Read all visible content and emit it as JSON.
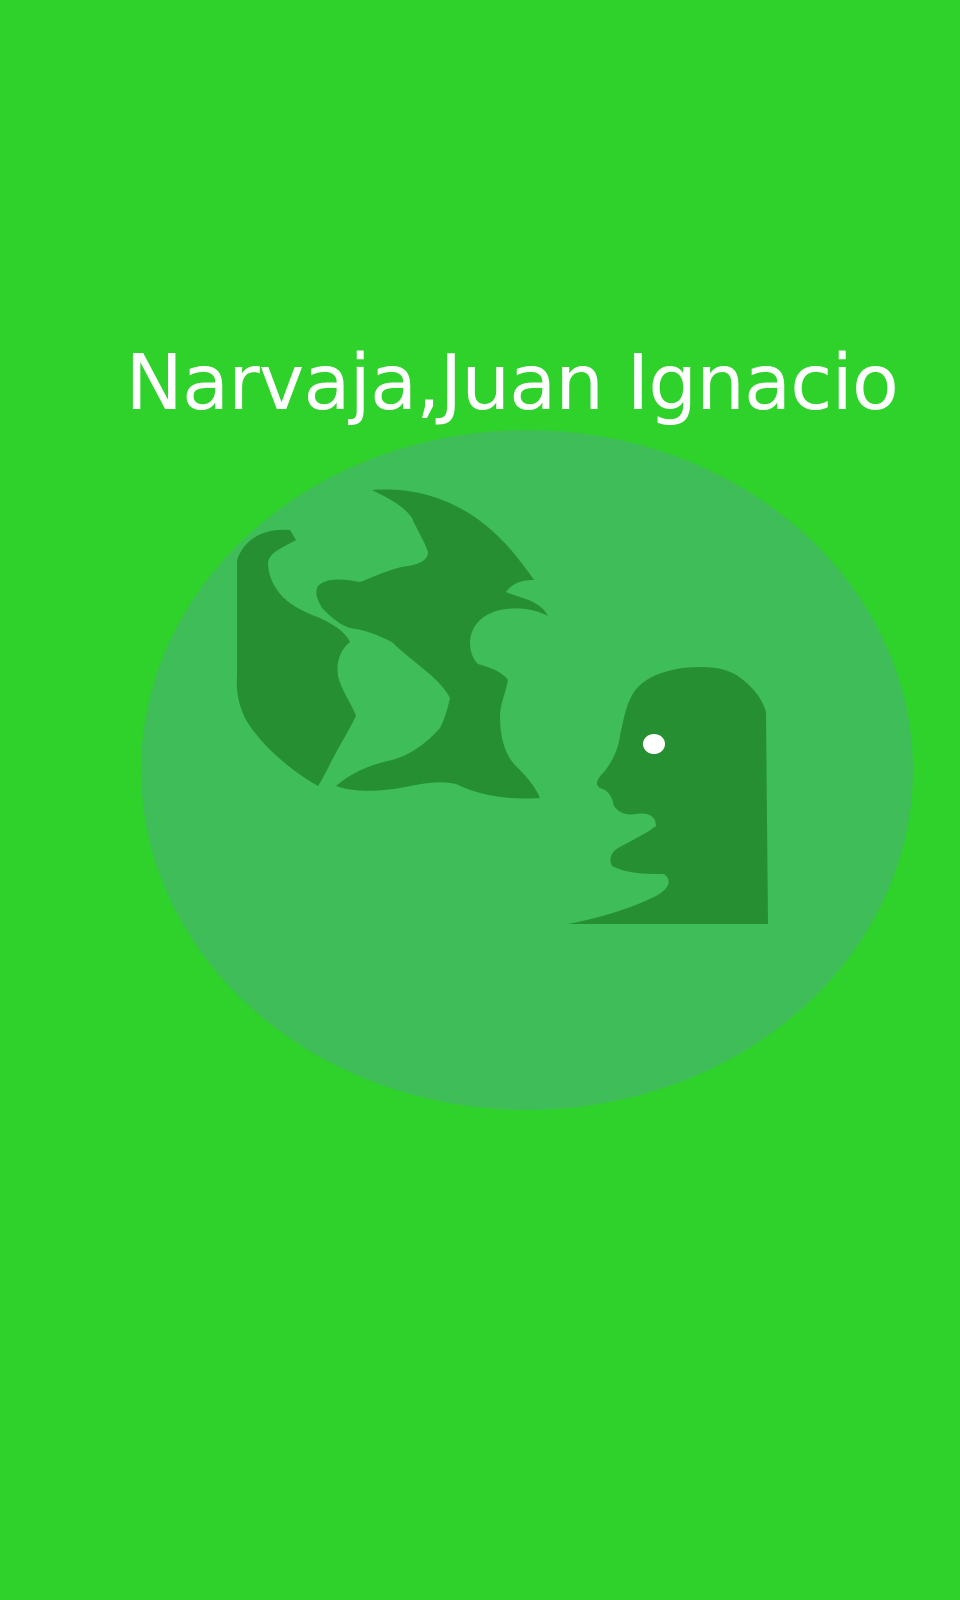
{
  "cover": {
    "author_name": "Narvaja,Juan Ignacio",
    "emblem_icon": "globe-with-speaking-head-icon"
  },
  "colors": {
    "background": "#2ED22A",
    "emblem_circle": "#3FBD58",
    "emblem_shapes": "#268F32",
    "eye": "#FFFFFF",
    "text": "#FFFFFF"
  }
}
